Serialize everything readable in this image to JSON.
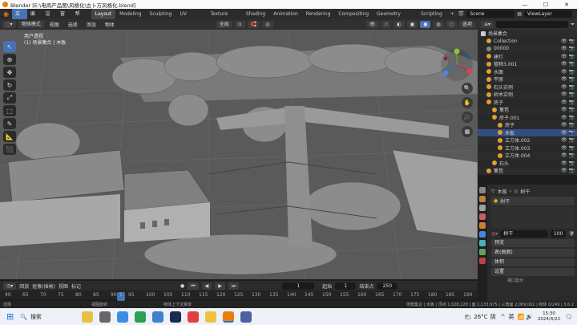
{
  "titlebar": {
    "title": "Blender [E:\\电商产品图\\风格化\\古卜方风格化.blend]",
    "minimize": "—",
    "maximize": "☐",
    "close": "✕"
  },
  "menus": [
    "文件",
    "编辑",
    "渲染",
    "窗口",
    "帮助"
  ],
  "workspaces": [
    "Layout",
    "Modeling",
    "Sculpting",
    "UV Editing",
    "Texture Paint",
    "Shading",
    "Animation",
    "Rendering",
    "Compositing",
    "Geometry Nodes",
    "Scripting"
  ],
  "add_workspace": "+",
  "scene": {
    "scene_label": "Scene",
    "viewlayer_label": "ViewLayer"
  },
  "viewport_header": {
    "mode": "物体模式",
    "menus": [
      "视图",
      "选择",
      "添加",
      "物体"
    ],
    "transform": "全局",
    "options": "选项"
  },
  "viewport": {
    "view_name": "用户透视",
    "collection_path": "(1) 场景集合 | 木板"
  },
  "tools": [
    "↖",
    "⊕",
    "✥",
    "↻",
    "⤢",
    "⬚",
    "✎",
    "📐",
    "⬛"
  ],
  "outliner": {
    "search_placeholder": "",
    "rows": [
      {
        "label": "场景集合",
        "indent": 0,
        "color": "#cccccc"
      },
      {
        "label": "Collection",
        "indent": 1,
        "color": "#e0a030"
      },
      {
        "label": "00000",
        "indent": 1,
        "color": "#888888"
      },
      {
        "label": "建灯",
        "indent": 1,
        "color": "#e0a030"
      },
      {
        "label": "植物3.001",
        "indent": 1,
        "color": "#e0a030"
      },
      {
        "label": "水面",
        "indent": 1,
        "color": "#e0a030"
      },
      {
        "label": "平原",
        "indent": 1,
        "color": "#e0a030"
      },
      {
        "label": "石头实例",
        "indent": 1,
        "color": "#e0a030"
      },
      {
        "label": "树木实例",
        "indent": 1,
        "color": "#e0a030"
      },
      {
        "label": "房子",
        "indent": 1,
        "color": "#e0a030"
      },
      {
        "label": "篱笆",
        "indent": 2,
        "color": "#e0a030"
      },
      {
        "label": "房子.001",
        "indent": 2,
        "color": "#e0a030"
      },
      {
        "label": "房子",
        "indent": 3,
        "color": "#e0a030"
      },
      {
        "label": "木板",
        "indent": 3,
        "color": "#e0a030",
        "selected": true
      },
      {
        "label": "立方体.002",
        "indent": 3,
        "color": "#e0a030"
      },
      {
        "label": "立方体.003",
        "indent": 3,
        "color": "#e0a030"
      },
      {
        "label": "立方体.004",
        "indent": 3,
        "color": "#e0a030"
      },
      {
        "label": "石头",
        "indent": 2,
        "color": "#e0a030"
      },
      {
        "label": "篱笆",
        "indent": 1,
        "color": "#e0a030"
      }
    ]
  },
  "properties": {
    "object_name": "木板",
    "material_name": "树干",
    "material_slot": "树干",
    "users": "100",
    "panels": [
      "预览",
      "表(曲面)",
      "体积",
      "设置"
    ],
    "node_label": "视口显示",
    "search_placeholder": ""
  },
  "timeline": {
    "menus": [
      "回放",
      "抠像(插帧)",
      "视图",
      "标记"
    ],
    "current_frame": "1",
    "start_label": "起始",
    "start_value": "1",
    "end_label": "结束点",
    "end_value": "250",
    "ruler": [
      "40",
      "65",
      "70",
      "75",
      "80",
      "85",
      "90",
      "95",
      "100",
      "105",
      "110",
      "115",
      "120",
      "125",
      "130",
      "135",
      "140",
      "145",
      "150",
      "155",
      "160",
      "165",
      "170",
      "175",
      "180",
      "185",
      "190"
    ]
  },
  "statusbar": {
    "left": "选择",
    "mid": "视图旋转",
    "mid2": "物体上下文菜单",
    "right": "场景集合 | 木板 | 顶点 1,028,228 | 面 1,133,975 | 三角面 2,009,002 | 物体 0/249 | 3.6.2"
  },
  "taskbar": {
    "search": "搜索",
    "temp": "26°C",
    "weather": "阴",
    "lang": "英",
    "time": "15:30",
    "date": "2024/4/22"
  }
}
